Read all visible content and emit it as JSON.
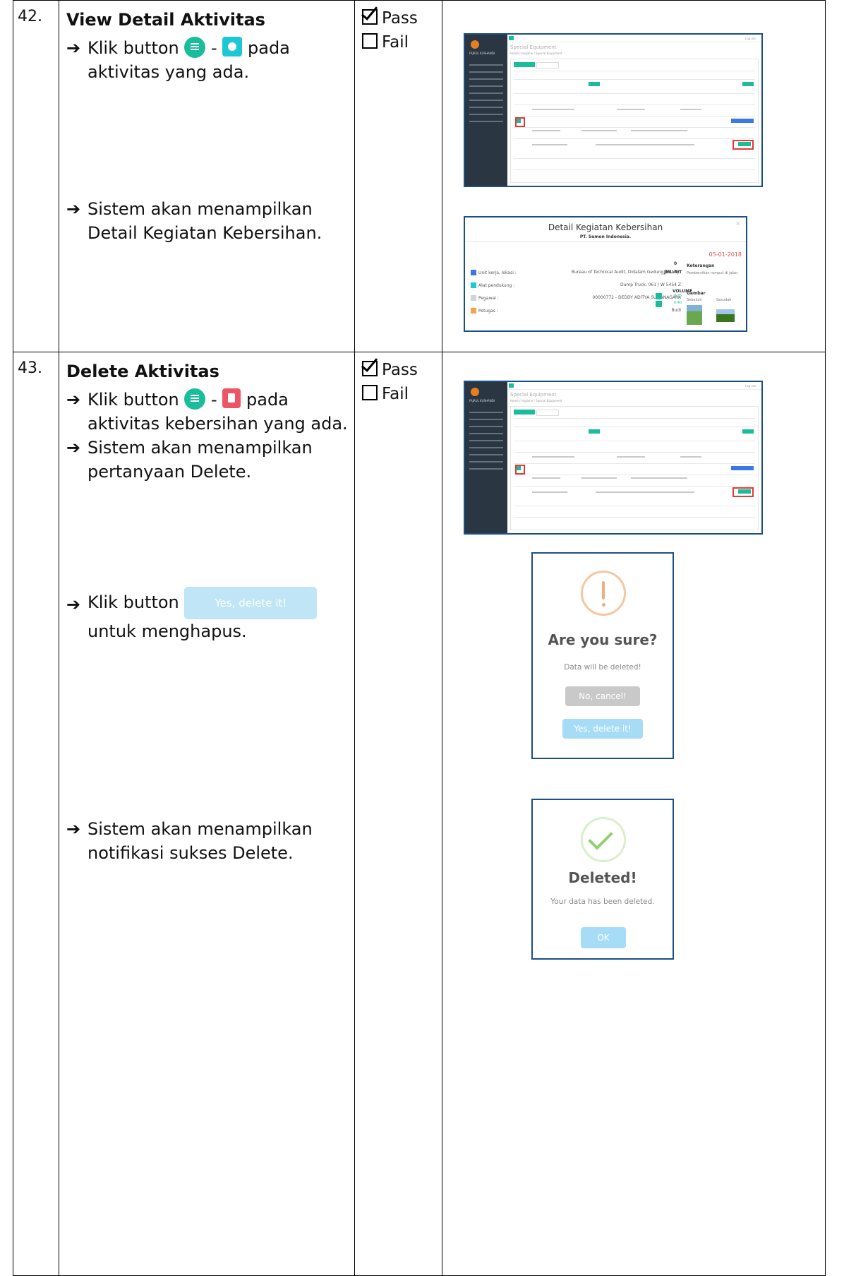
{
  "row42": {
    "number": "42.",
    "title": "View Detail Aktivitas",
    "line1_a": "Klik button",
    "line1_dash": "-",
    "line1_b": "pada",
    "line1_c": "aktivitas yang ada.",
    "line2_a": "Sistem akan menampilkan",
    "line2_b": "Detail Kegiatan Kebersihan.",
    "pass": "Pass",
    "fail": "Fail"
  },
  "row43": {
    "number": "43.",
    "title": "Delete Aktivitas",
    "line1_a": "Klik button",
    "line1_dash": "-",
    "line1_b": "pada",
    "line1_c": "aktivitas kebersihan yang ada.",
    "line2_a": "Sistem akan menampilkan",
    "line2_b": "pertanyaan Delete.",
    "line3_a": "Klik button",
    "line3_btn": "Yes, delete it!",
    "line3_b": "untuk menghapus.",
    "line4_a": "Sistem akan menampilkan",
    "line4_b": "notifikasi sukses Delete.",
    "pass": "Pass",
    "fail": "Fail"
  },
  "app": {
    "page_title": "Special Equipment",
    "breadcrumb": "Home / Hygiene / Special Equipment",
    "logout": "Log out",
    "user": "FAJRUL KUSHANDI"
  },
  "detail": {
    "title": "Detail Kegiatan Kebersihan",
    "subtitle": "PT. Semen Indonesia.",
    "date": "05-01-2018",
    "unit_label": "Unit kerja, lokasi :",
    "unit_value": "Bureau of Technical Audit, Didalam Gedung (Lobby)",
    "alat_label": "Alat pendukung :",
    "alat_value": "Dump Truck, 061 / W 5454 Z",
    "pegawai_label": "Pegawai :",
    "pegawai_value": "00000772 - DEDDY ADITYA SUMANAGARA",
    "petugas_label": "Petugas :",
    "petugas_value": "Budi",
    "jml_rit_label": "JML.RIT",
    "jml_rit_value": "0",
    "volume_label": "VOLUME",
    "vol1": "0.25",
    "vol2": "0.40",
    "keterangan_label": "Keterangan",
    "keterangan_value": "Pembersihan rumput di jalan.",
    "gambar_label": "Gambar",
    "sebelum": "Sebelum",
    "sesudah": "Sesudah"
  },
  "confirm": {
    "title": "Are you sure?",
    "text": "Data will be deleted!",
    "cancel": "No, cancel!",
    "confirm": "Yes, delete it!"
  },
  "success": {
    "title": "Deleted!",
    "text": "Your data has been deleted.",
    "ok": "OK"
  },
  "colors": {
    "accent_green": "#1abc9c",
    "teal": "#1ec7d4",
    "danger": "#ed5565",
    "confirm_btn": "#a6dcf5",
    "cancel_btn": "#c9c9c9"
  }
}
